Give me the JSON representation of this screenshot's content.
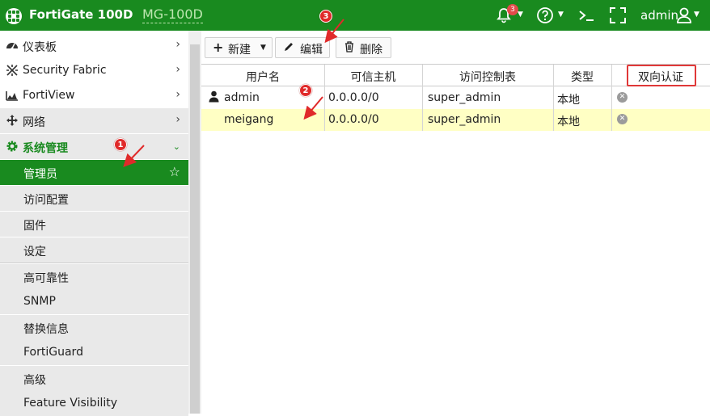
{
  "topbar": {
    "brand": "FortiGate 100D",
    "model": "MG-100D",
    "notification_count": "3",
    "user": "admin",
    "icons": [
      "bell-icon",
      "help-icon",
      "cli-console-icon",
      "fullscreen-icon",
      "user-icon"
    ]
  },
  "sidebar": {
    "items": [
      {
        "label": "仪表板",
        "icon": "dashboard-icon"
      },
      {
        "label": "Security Fabric",
        "icon": "security-fabric-icon"
      },
      {
        "label": "FortiView",
        "icon": "fortiview-icon"
      },
      {
        "label": "网络",
        "icon": "network-icon"
      },
      {
        "label": "系统管理",
        "icon": "gear-icon"
      }
    ],
    "sub_items": [
      "管理员",
      "访问配置",
      "固件",
      "设定",
      "高可靠性",
      "SNMP",
      "替换信息",
      "FortiGuard",
      "高级",
      "Feature Visibility"
    ]
  },
  "toolbar": {
    "new_label": "新建",
    "edit_label": "编辑",
    "delete_label": "删除"
  },
  "table": {
    "columns": [
      "用户名",
      "可信主机",
      "访问控制表",
      "类型",
      "双向认证"
    ],
    "rows": [
      {
        "username": "admin",
        "trusted_host": "0.0.0.0/0",
        "profile": "super_admin",
        "type": "本地"
      },
      {
        "username": "meigang",
        "trusted_host": "0.0.0.0/0",
        "profile": "super_admin",
        "type": "本地"
      }
    ]
  },
  "annotations": [
    "1",
    "2",
    "3"
  ],
  "colors": {
    "accent": "#198a1f",
    "selected_row": "#ffffc4",
    "annotation": "#e02a2a"
  }
}
